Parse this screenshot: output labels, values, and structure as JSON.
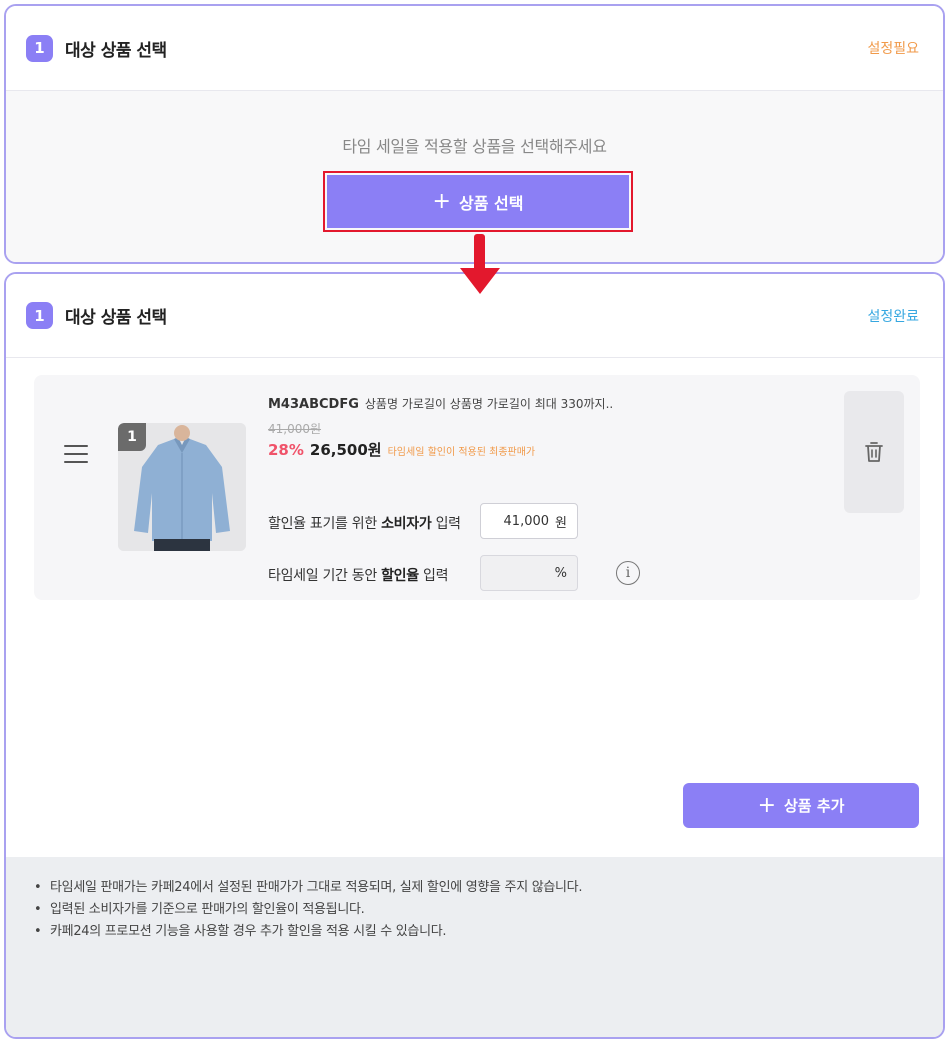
{
  "top_panel": {
    "step": "1",
    "title": "대상 상품 선택",
    "status": "설정필요",
    "empty_message": "타임 세일을 적용할 상품을 선택해주세요",
    "select_button_label": "상품 선택"
  },
  "bottom_panel": {
    "step": "1",
    "title": "대상 상품 선택",
    "status": "설정완료",
    "product": {
      "index": "1",
      "code": "M43ABCDFG",
      "name": "상품명 가로길이 상품명 가로길이 최대 330까지..",
      "original_price": "41,000원",
      "discount_rate": "28%",
      "final_price": "26,500원",
      "final_price_note": "타임세일 할인이 적용된 최종판매가",
      "consumer_price_label_pre": "할인율 표기를 위한 ",
      "consumer_price_label_bold": "소비자가",
      "consumer_price_label_post": " 입력",
      "consumer_price_value": "41,000",
      "consumer_price_unit": "원",
      "rate_label_pre": "타임세일 기간 동안 ",
      "rate_label_bold": "할인율",
      "rate_label_post": " 입력",
      "rate_value": "",
      "rate_unit": "%"
    },
    "add_button_label": "상품 추가",
    "notes": [
      "타임세일 판매가는 카페24에서 설정된 판매가가 그대로 적용되며, 실제 할인에 영향을 주지 않습니다.",
      "입력된 소비자가를 기준으로 판매가의 할인율이 적용됩니다.",
      "카페24의 프로모션 기능을 사용할 경우 추가 할인을 적용 시킬 수 있습니다."
    ]
  },
  "colors": {
    "accent": "#8b7ff5",
    "panel_border": "#a9a1f0",
    "status_required": "#f19a4a",
    "status_done": "#36a7e0",
    "highlight": "#e3182d",
    "discount": "#f0536a"
  },
  "icons": [
    "plus-icon",
    "down-arrow-icon",
    "drag-handle-icon",
    "trash-icon",
    "info-icon"
  ]
}
